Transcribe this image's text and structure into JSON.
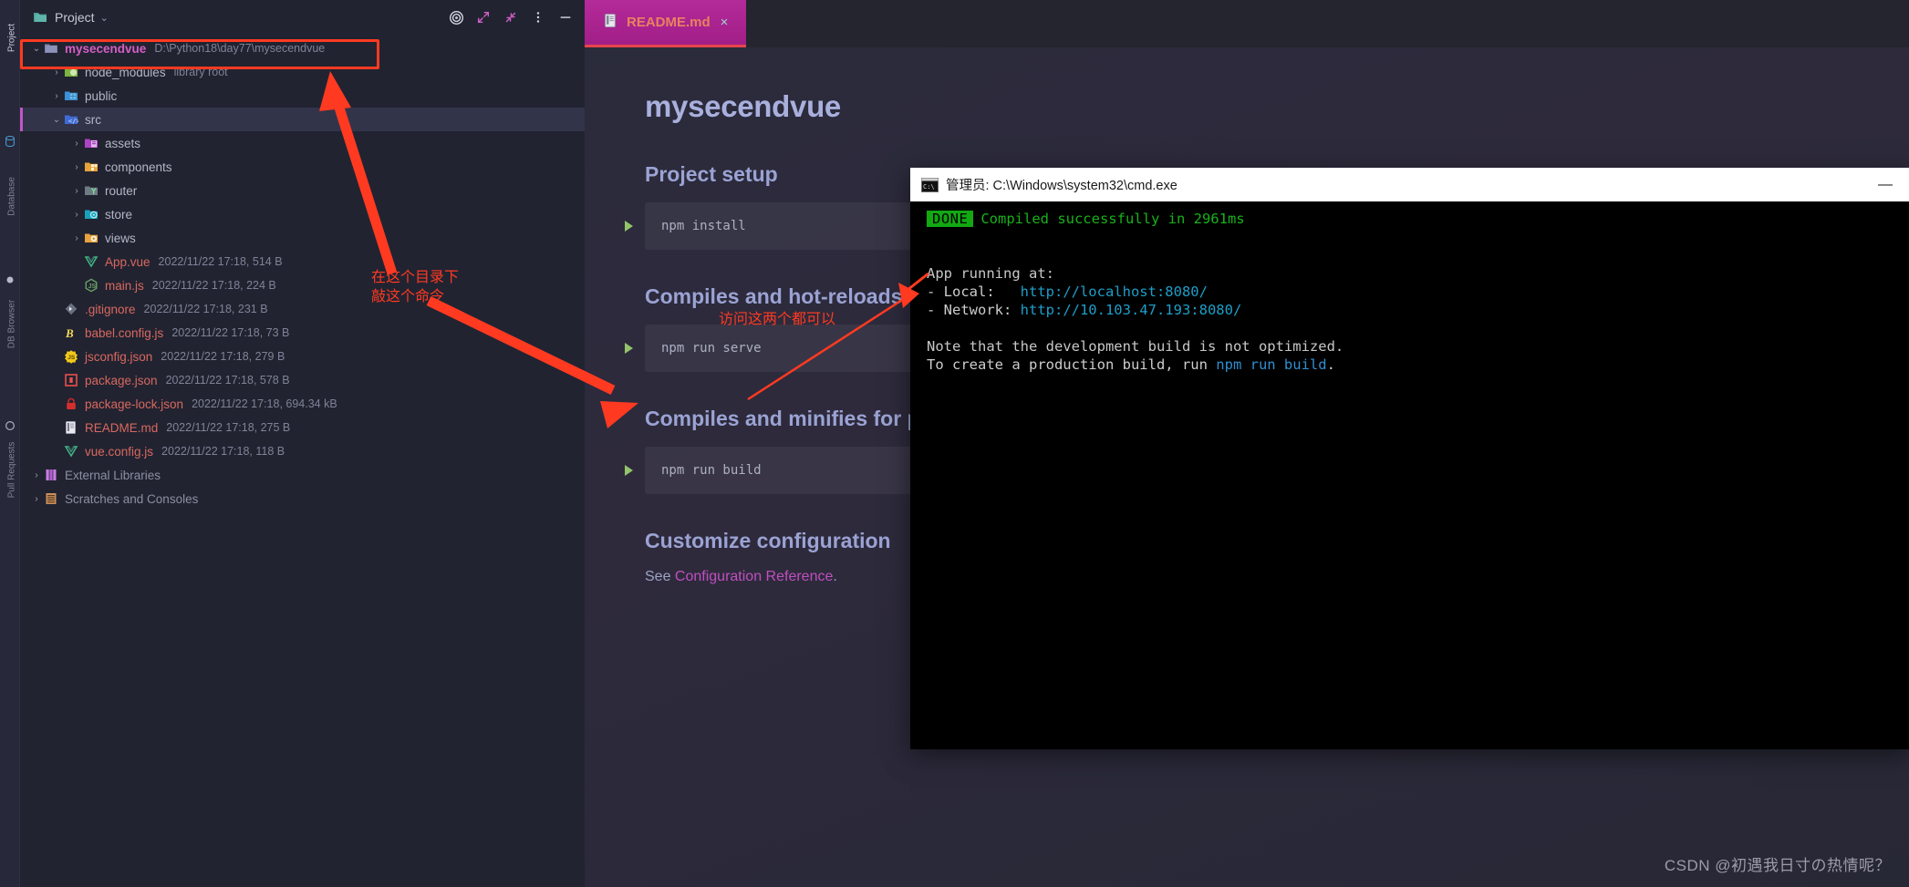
{
  "toolstrip": {
    "labels": [
      {
        "text": "Project",
        "active": true
      },
      {
        "text": "Database",
        "active": false
      },
      {
        "text": "DB Browser",
        "active": false
      },
      {
        "text": "Pull Requests",
        "active": false
      }
    ]
  },
  "panel": {
    "title": "Project",
    "folder_icon": "folder-icon",
    "chevron": "⌄",
    "actions": [
      {
        "name": "locate-target-icon",
        "glyph": "◎"
      },
      {
        "name": "expand-all-icon",
        "glyph": ""
      },
      {
        "name": "collapse-all-icon",
        "glyph": ""
      },
      {
        "name": "more-options-icon",
        "glyph": "⋮"
      },
      {
        "name": "hide-panel-icon",
        "glyph": "—"
      }
    ]
  },
  "tree": [
    {
      "indent": 0,
      "twist": "⌄",
      "icon": "folder-module-icon",
      "name": "mysecendvue",
      "style": "pink",
      "info": "D:\\Python18\\day77\\mysecendvue",
      "selected": false,
      "highlighted": true
    },
    {
      "indent": 1,
      "twist": "›",
      "icon": "folder-node-modules-icon",
      "name": "node_modules",
      "style": "gray",
      "info": "library root",
      "selected": false
    },
    {
      "indent": 1,
      "twist": "›",
      "icon": "folder-public-icon",
      "name": "public",
      "style": "gray",
      "info": "",
      "selected": false
    },
    {
      "indent": 1,
      "twist": "⌄",
      "icon": "folder-source-icon",
      "name": "src",
      "style": "gray",
      "info": "",
      "selected": true
    },
    {
      "indent": 2,
      "twist": "›",
      "icon": "folder-assets-icon",
      "name": "assets",
      "style": "gray",
      "info": "",
      "selected": false
    },
    {
      "indent": 2,
      "twist": "›",
      "icon": "folder-components-icon",
      "name": "components",
      "style": "gray",
      "info": "",
      "selected": false
    },
    {
      "indent": 2,
      "twist": "›",
      "icon": "folder-router-icon",
      "name": "router",
      "style": "gray",
      "info": "",
      "selected": false
    },
    {
      "indent": 2,
      "twist": "›",
      "icon": "folder-store-icon",
      "name": "store",
      "style": "gray",
      "info": "",
      "selected": false
    },
    {
      "indent": 2,
      "twist": "›",
      "icon": "folder-views-icon",
      "name": "views",
      "style": "gray",
      "info": "",
      "selected": false
    },
    {
      "indent": 2,
      "twist": "",
      "icon": "vue-file-icon",
      "name": "App.vue",
      "style": "red",
      "info": "2022/11/22 17:18, 514 B",
      "selected": false
    },
    {
      "indent": 2,
      "twist": "",
      "icon": "js-node-file-icon",
      "name": "main.js",
      "style": "red",
      "info": "2022/11/22 17:18, 224 B",
      "selected": false
    },
    {
      "indent": 1,
      "twist": "",
      "icon": "gitignore-file-icon",
      "name": ".gitignore",
      "style": "red",
      "info": "2022/11/22 17:18, 231 B",
      "selected": false
    },
    {
      "indent": 1,
      "twist": "",
      "icon": "babel-file-icon",
      "name": "babel.config.js",
      "style": "red",
      "info": "2022/11/22 17:18, 73 B",
      "selected": false
    },
    {
      "indent": 1,
      "twist": "",
      "icon": "jsconfig-file-icon",
      "name": "jsconfig.json",
      "style": "red",
      "info": "2022/11/22 17:18, 279 B",
      "selected": false
    },
    {
      "indent": 1,
      "twist": "",
      "icon": "package-json-file-icon",
      "name": "package.json",
      "style": "red",
      "info": "2022/11/22 17:18, 578 B",
      "selected": false
    },
    {
      "indent": 1,
      "twist": "",
      "icon": "lock-file-icon",
      "name": "package-lock.json",
      "style": "red",
      "info": "2022/11/22 17:18, 694.34 kB",
      "selected": false
    },
    {
      "indent": 1,
      "twist": "",
      "icon": "markdown-file-icon",
      "name": "README.md",
      "style": "red",
      "info": "2022/11/22 17:18, 275 B",
      "selected": false
    },
    {
      "indent": 1,
      "twist": "",
      "icon": "vue-file-icon",
      "name": "vue.config.js",
      "style": "red",
      "info": "2022/11/22 17:18, 118 B",
      "selected": false
    },
    {
      "indent": 0,
      "twist": "›",
      "icon": "external-libraries-icon",
      "name": "External Libraries",
      "style": "muted",
      "info": "",
      "selected": false
    },
    {
      "indent": 0,
      "twist": "›",
      "icon": "scratches-icon",
      "name": "Scratches and Consoles",
      "style": "muted",
      "info": "",
      "selected": false
    }
  ],
  "editor": {
    "tab": {
      "label": "README.md",
      "icon": "markdown-file-icon",
      "close": "×"
    },
    "markdown": {
      "h1": "mysecendvue",
      "sections": [
        {
          "heading": "Project setup",
          "code": "npm install"
        },
        {
          "heading": "Compiles and hot-reloads for development",
          "code": "npm run serve"
        },
        {
          "heading": "Compiles and minifies for production",
          "code": "npm run build"
        }
      ],
      "customize_heading": "Customize configuration",
      "see_text": "See ",
      "see_link": "Configuration Reference",
      "see_suffix": "."
    }
  },
  "cmd": {
    "title": "管理员: C:\\Windows\\system32\\cmd.exe",
    "minimize": "—",
    "done_badge": "DONE",
    "compiled_line": "Compiled successfully in 2961ms",
    "app_running": "App running at:",
    "local_label": "- Local:   ",
    "local_url": "http://localhost:8080/",
    "network_label": "- Network: ",
    "network_url": "http://10.103.47.193:8080/",
    "note_line1": "Note that the development build is not optimized.",
    "note_line2_prefix": "To create a production build, run ",
    "note_line2_cmd": "npm run build",
    "note_line2_suffix": "."
  },
  "annotations": {
    "dir_note": "在这个目录下\n敲这个命令",
    "urls_note": "访问这两个都可以",
    "highlight_color": "#ff3a21"
  },
  "watermark": "CSDN @初遇我日寸の热情呢？"
}
